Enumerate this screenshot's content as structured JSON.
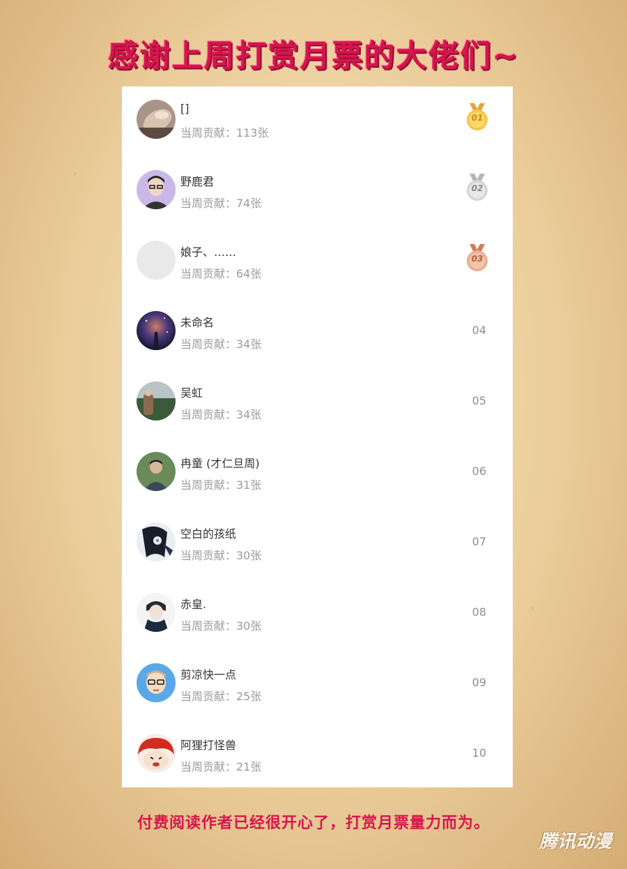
{
  "header": {
    "title": "感谢上周打赏月票的大佬们~"
  },
  "list": [
    {
      "name": "[]",
      "contribution": "当周贡献：113张",
      "rank": "01",
      "medal": "gold"
    },
    {
      "name": "野鹿君",
      "contribution": "当周贡献：74张",
      "rank": "02",
      "medal": "silver"
    },
    {
      "name": "娘子、……",
      "contribution": "当周贡献：64张",
      "rank": "03",
      "medal": "bronze"
    },
    {
      "name": "未命名",
      "contribution": "当周贡献：34张",
      "rank": "04"
    },
    {
      "name": "吴虹",
      "contribution": "当周贡献：34张",
      "rank": "05"
    },
    {
      "name": "冉童 (才仁旦周)",
      "contribution": "当周贡献：31张",
      "rank": "06"
    },
    {
      "name": "空白的孩纸",
      "contribution": "当周贡献：30张",
      "rank": "07"
    },
    {
      "name": "赤皇.",
      "contribution": "当周贡献：30张",
      "rank": "08"
    },
    {
      "name": "剪凉快一点",
      "contribution": "当周贡献：25张",
      "rank": "09"
    },
    {
      "name": "阿狸打怪兽",
      "contribution": "当周贡献：21张",
      "rank": "10"
    }
  ],
  "footer": {
    "text": "付费阅读作者已经很开心了，打赏月票量力而为。"
  },
  "watermark": {
    "text": "腾讯动漫"
  },
  "colors": {
    "accent": "#d6154d",
    "gold": "#f2b53a",
    "silver": "#c8c8c8",
    "bronze": "#e39a76"
  }
}
